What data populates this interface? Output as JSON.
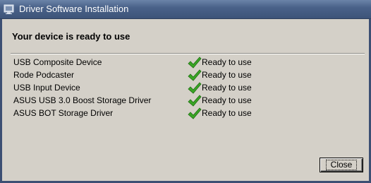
{
  "window": {
    "title": "Driver Software Installation",
    "icon": "driver-install-icon"
  },
  "main": {
    "heading": "Your device is ready to use",
    "devices": [
      {
        "name": "USB Composite Device",
        "status": "Ready to use"
      },
      {
        "name": "Rode Podcaster",
        "status": "Ready to use"
      },
      {
        "name": "USB Input Device",
        "status": "Ready to use"
      },
      {
        "name": "ASUS USB 3.0 Boost Storage Driver",
        "status": "Ready to use"
      },
      {
        "name": "ASUS BOT Storage Driver",
        "status": "Ready to use"
      }
    ],
    "status_icon": "green-check-icon"
  },
  "footer": {
    "close_label": "Close"
  },
  "colors": {
    "titlebar": "#4a6289",
    "client_background": "#d4d0c8",
    "check_green": "#3aa626"
  }
}
